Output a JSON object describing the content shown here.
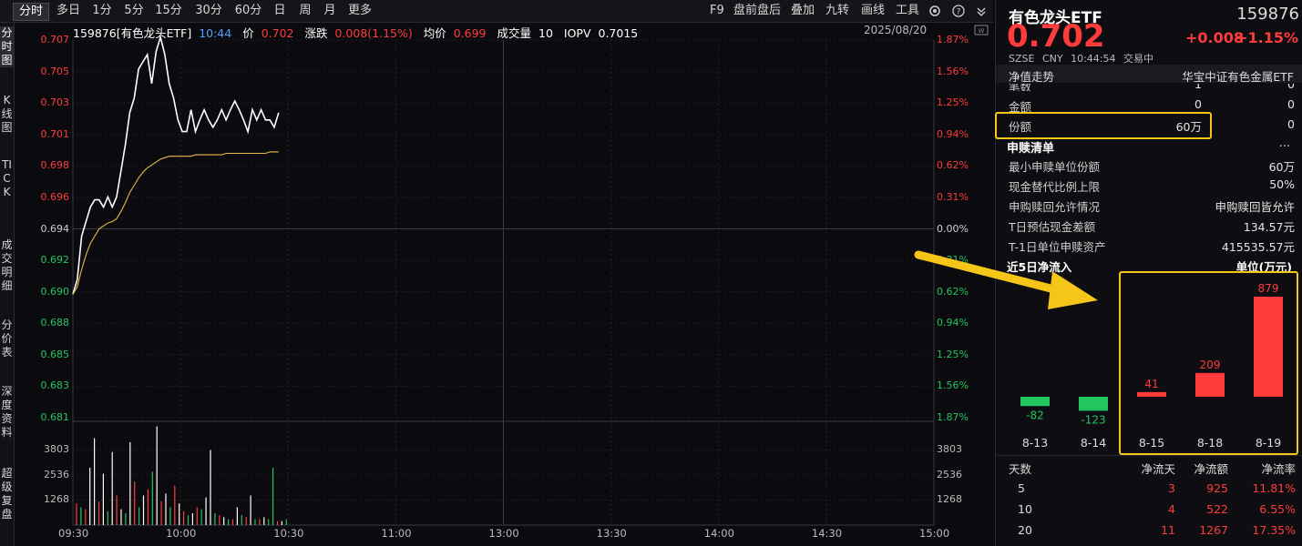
{
  "tabs": [
    "分时",
    "多日",
    "1分",
    "5分",
    "15分",
    "30分",
    "60分",
    "日",
    "周",
    "月",
    "更多"
  ],
  "tools": [
    "F9",
    "盘前盘后",
    "叠加",
    "九转",
    "画线",
    "工具"
  ],
  "side_tabs": [
    "分时图",
    "K线图",
    "TICK",
    "成交明细",
    "分价表",
    "深度资料",
    "超级复盘"
  ],
  "info": {
    "code_name": "159876[有色龙头ETF]",
    "time": "10:44",
    "price_label": "价",
    "price": "0.702",
    "change_label": "涨跌",
    "change": "0.008(1.15%)",
    "avg_label": "均价",
    "avg": "0.699",
    "vol_label": "成交量",
    "vol": "10",
    "iopv_label": "IOPV",
    "iopv": "0.7015",
    "date": "2025/08/20"
  },
  "chart_data": {
    "type": "line",
    "xlabel": "",
    "ylabel": "",
    "x_ticks": [
      "09:30",
      "10:00",
      "10:30",
      "11:00",
      "13:00",
      "13:30",
      "14:00",
      "14:30",
      "15:00"
    ],
    "price_ticks": [
      "0.707",
      "0.705",
      "0.703",
      "0.701",
      "0.698",
      "0.696",
      "0.694",
      "0.692",
      "0.690",
      "0.688",
      "0.685",
      "0.683",
      "0.681"
    ],
    "pct_ticks": [
      "1.87%",
      "1.56%",
      "1.25%",
      "0.94%",
      "0.62%",
      "0.31%",
      "0.00%",
      "0.31%",
      "0.62%",
      "0.94%",
      "1.25%",
      "1.56%",
      "1.87%"
    ],
    "ylim": [
      0.681,
      0.707
    ],
    "volume_ticks": [
      "3803",
      "2536",
      "1268"
    ],
    "series": [
      {
        "values": [
          0.6895,
          0.6905,
          0.6935,
          0.6945,
          0.6955,
          0.696,
          0.696,
          0.6955,
          0.6962,
          0.6955,
          0.6962,
          0.698,
          0.6998,
          0.702,
          0.703,
          0.705,
          0.7055,
          0.706,
          0.704,
          0.7062,
          0.7072,
          0.706,
          0.704,
          0.703,
          0.7015,
          0.7007,
          0.7007,
          0.7022,
          0.7007,
          0.7015,
          0.7022,
          0.7015,
          0.701,
          0.7015,
          0.7022,
          0.7015,
          0.7022,
          0.7028,
          0.7022,
          0.7015,
          0.7007,
          0.7022,
          0.7015,
          0.7022,
          0.7015,
          0.7015,
          0.701,
          0.702
        ]
      },
      {
        "values": [
          0.6895,
          0.69,
          0.6912,
          0.6922,
          0.693,
          0.6935,
          0.694,
          0.6942,
          0.6944,
          0.6945,
          0.6947,
          0.6952,
          0.6958,
          0.6965,
          0.697,
          0.6975,
          0.6979,
          0.6982,
          0.6984,
          0.6986,
          0.6988,
          0.6989,
          0.699,
          0.699,
          0.699,
          0.699,
          0.699,
          0.699,
          0.6991,
          0.6991,
          0.6991,
          0.6991,
          0.6991,
          0.6991,
          0.6991,
          0.6992,
          0.6992,
          0.6992,
          0.6992,
          0.6992,
          0.6992,
          0.6992,
          0.6992,
          0.6992,
          0.6992,
          0.6993,
          0.6993,
          0.6993
        ]
      }
    ],
    "volume": [
      1100,
      900,
      800,
      2900,
      4400,
      1200,
      2600,
      700,
      3700,
      1500,
      800,
      600,
      4200,
      2200,
      900,
      1500,
      1800,
      2700,
      5000,
      1200,
      1600,
      900,
      2000,
      1100,
      700,
      500,
      600,
      900,
      800,
      1400,
      3800,
      600,
      500,
      400,
      300,
      300,
      900,
      500,
      400,
      1500,
      300,
      300,
      400,
      300,
      2900,
      200,
      200,
      300
    ]
  },
  "volume_bar_colors": [
    "r",
    "g",
    "r",
    "w",
    "w",
    "r",
    "w",
    "g",
    "w",
    "r",
    "w",
    "g",
    "w",
    "r",
    "g",
    "w",
    "r",
    "g",
    "w",
    "r",
    "w",
    "g",
    "r",
    "w",
    "r",
    "g",
    "w",
    "r",
    "g",
    "w",
    "w",
    "g",
    "r",
    "w",
    "g",
    "r",
    "w",
    "g",
    "r",
    "w",
    "g",
    "r",
    "w",
    "g",
    "g",
    "r",
    "w",
    "g"
  ],
  "panel": {
    "name": "有色龙头ETF",
    "code": "159876",
    "price": "0.702",
    "change": "+0.008",
    "pct": "+1.15%",
    "market": "SZSE",
    "currency": "CNY",
    "time": "10:44:54",
    "status": "交易中",
    "nav_label": "净值走势",
    "index_name": "华宝中证有色金属ETF",
    "rows_top": [
      {
        "label": "笔数",
        "mid": "1",
        "right": "0"
      },
      {
        "label": "金额",
        "mid": "0",
        "right": "0"
      },
      {
        "label": "份额",
        "mid": "60万",
        "right": "0"
      }
    ],
    "subscribe_title": "申赎清单",
    "more": "...",
    "subscribe_rows": [
      {
        "label": "最小申赎单位份额",
        "value": "60万"
      },
      {
        "label": "现金替代比例上限",
        "value": "50%"
      },
      {
        "label": "申购赎回允许情况",
        "value": "申购赎回皆允许"
      },
      {
        "label": "T日预估现金差额",
        "value": "134.57元"
      },
      {
        "label": "T-1日单位申赎资产",
        "value": "415535.57元"
      }
    ],
    "flow_title": "近5日净流入",
    "flow_unit": "单位(万元)",
    "flow": {
      "dates": [
        "8-13",
        "8-14",
        "8-15",
        "8-18",
        "8-19"
      ],
      "values": [
        -82,
        -123,
        41,
        209,
        879
      ],
      "labels": [
        "-82",
        "-123",
        "41",
        "209",
        "879"
      ]
    },
    "stats_headers": [
      "天数",
      "净流天",
      "净流额",
      "净流率"
    ],
    "stats": [
      {
        "days": "5",
        "flow_days": "3",
        "amount": "925",
        "rate": "11.81%"
      },
      {
        "days": "10",
        "flow_days": "4",
        "amount": "522",
        "rate": "6.55%"
      },
      {
        "days": "20",
        "flow_days": "11",
        "amount": "1267",
        "rate": "17.35%"
      }
    ]
  },
  "colors": {
    "up": "#ff3b3b",
    "down": "#22c55e",
    "highlight": "#f5c518"
  }
}
